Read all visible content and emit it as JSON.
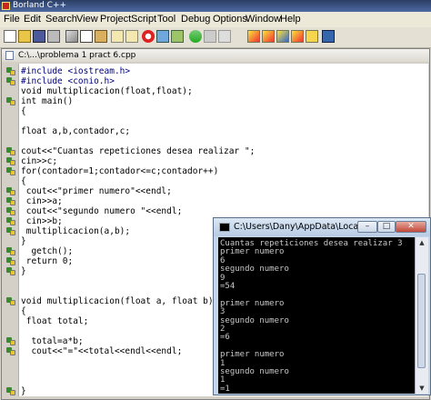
{
  "app": {
    "title": "Borland C++"
  },
  "menu": [
    "File",
    "Edit",
    "Search",
    "View",
    "Project",
    "Script",
    "Tool",
    "Debug",
    "Options",
    "Window",
    "Help"
  ],
  "toolbar_icons": [
    "new-file-icon",
    "open-folder-icon",
    "save-icon",
    "print-icon",
    "cut-icon",
    "copy-icon",
    "paste-icon",
    "find-icon",
    "replace-icon",
    "stop-icon",
    "compile-icon",
    "run-icon",
    "undo-icon",
    "redo-icon",
    "breakpoint-icon",
    "step-into-icon",
    "step-over-icon",
    "run-to-icon",
    "make-icon",
    "inspect-icon",
    "exit-icon"
  ],
  "editor": {
    "title": "C:\\...\\problema 1 pract 6.cpp",
    "lines": [
      {
        "code": "#include <iostream.h>",
        "marker": true,
        "cls": "kw"
      },
      {
        "code": "#include <conio.h>",
        "marker": true,
        "cls": "kw"
      },
      {
        "code": "void multiplicacion(float,float);",
        "marker": false,
        "cls": ""
      },
      {
        "code": "int main()",
        "marker": true,
        "cls": ""
      },
      {
        "code": "{",
        "marker": false,
        "cls": ""
      },
      {
        "code": "",
        "marker": false,
        "cls": ""
      },
      {
        "code": "float a,b,contador,c;",
        "marker": false,
        "cls": ""
      },
      {
        "code": "",
        "marker": false,
        "cls": ""
      },
      {
        "code": "cout<<\"Cuantas repeticiones desea realizar \";",
        "marker": true,
        "cls": ""
      },
      {
        "code": "cin>>c;",
        "marker": true,
        "cls": ""
      },
      {
        "code": "for(contador=1;contador<=c;contador++)",
        "marker": true,
        "cls": ""
      },
      {
        "code": "{",
        "marker": false,
        "cls": ""
      },
      {
        "code": " cout<<\"primer numero\"<<endl;",
        "marker": true,
        "cls": ""
      },
      {
        "code": " cin>>a;",
        "marker": true,
        "cls": ""
      },
      {
        "code": " cout<<\"segundo numero \"<<endl;",
        "marker": true,
        "cls": ""
      },
      {
        "code": " cin>>b;",
        "marker": true,
        "cls": ""
      },
      {
        "code": " multiplicacion(a,b);",
        "marker": true,
        "cls": ""
      },
      {
        "code": "}",
        "marker": false,
        "cls": ""
      },
      {
        "code": "  getch();",
        "marker": true,
        "cls": ""
      },
      {
        "code": " return 0;",
        "marker": true,
        "cls": ""
      },
      {
        "code": "}",
        "marker": true,
        "cls": ""
      },
      {
        "code": "",
        "marker": false,
        "cls": ""
      },
      {
        "code": "",
        "marker": false,
        "cls": ""
      },
      {
        "code": "void multiplicacion(float a, float b)",
        "marker": true,
        "cls": ""
      },
      {
        "code": "{",
        "marker": false,
        "cls": ""
      },
      {
        "code": " float total;",
        "marker": false,
        "cls": ""
      },
      {
        "code": "",
        "marker": false,
        "cls": ""
      },
      {
        "code": "  total=a*b;",
        "marker": true,
        "cls": ""
      },
      {
        "code": "  cout<<\"=\"<<total<<endl<<endl;",
        "marker": true,
        "cls": ""
      },
      {
        "code": "",
        "marker": false,
        "cls": ""
      },
      {
        "code": "",
        "marker": false,
        "cls": ""
      },
      {
        "code": "",
        "marker": false,
        "cls": ""
      },
      {
        "code": "}",
        "marker": true,
        "cls": ""
      }
    ]
  },
  "console": {
    "title": "C:\\Users\\Dany\\AppData\\Local\\Micros...",
    "lines": [
      "Cuantas repeticiones desea realizar 3",
      "primer numero",
      "6",
      "segundo numero",
      "9",
      "=54",
      "",
      "primer numero",
      "3",
      "segundo numero",
      "2",
      "=6",
      "",
      "primer numero",
      "1",
      "segundo numero",
      "1",
      "=1"
    ]
  }
}
